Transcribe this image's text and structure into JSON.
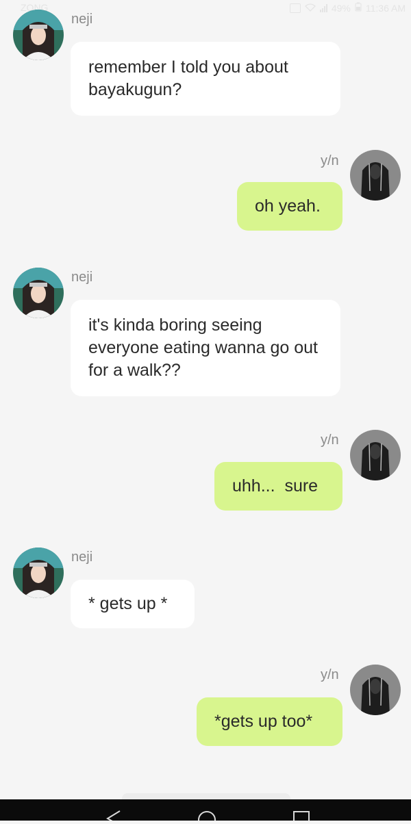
{
  "status_bar": {
    "carrier": "ZONG",
    "battery": "49%",
    "time": "11:36 AM"
  },
  "conversation": {
    "messages": [
      {
        "sender": "neji",
        "side": "in",
        "text": "remember I told you about bayakugun?"
      },
      {
        "sender": "y/n",
        "side": "out",
        "text": "oh yeah."
      },
      {
        "sender": "neji",
        "side": "in",
        "text": "it's kinda boring seeing everyone eating wanna go out for a walk??"
      },
      {
        "sender": "y/n",
        "side": "out",
        "text": "uhh...  sure"
      },
      {
        "sender": "neji",
        "side": "in",
        "text": "* gets up *"
      },
      {
        "sender": "y/n",
        "side": "out",
        "text": "*gets up too*"
      }
    ]
  },
  "colors": {
    "background": "#f5f5f5",
    "incoming_bubble": "#ffffff",
    "outgoing_bubble": "#d8f58e",
    "sender_name": "#8a8a8a",
    "nav_bar": "#0b0b0b"
  },
  "nav_bar": {
    "icons": [
      "back-icon",
      "home-icon",
      "recents-icon"
    ]
  }
}
